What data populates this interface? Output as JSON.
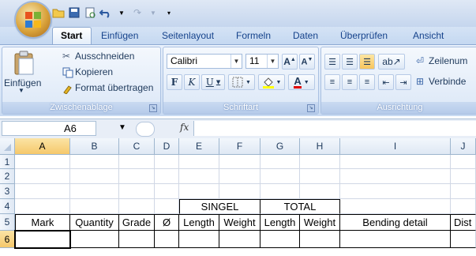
{
  "ribbon_tabs": [
    "Start",
    "Einfügen",
    "Seitenlayout",
    "Formeln",
    "Daten",
    "Überprüfen",
    "Ansicht"
  ],
  "active_tab": "Start",
  "clipboard": {
    "paste_label": "Einfügen",
    "cut_label": "Ausschneiden",
    "copy_label": "Kopieren",
    "format_painter_label": "Format übertragen",
    "group_label": "Zwischenablage"
  },
  "font": {
    "font_name": "Calibri",
    "font_size": "11",
    "bold": "F",
    "italic": "K",
    "underline": "U",
    "group_label": "Schriftart"
  },
  "alignment": {
    "wrap_label": "Zeilenum",
    "merge_label": "Verbinde",
    "group_label": "Ausrichtung"
  },
  "formula_bar": {
    "name_box": "A6",
    "fx_label": "fx",
    "formula": ""
  },
  "grid": {
    "columns": [
      "A",
      "B",
      "C",
      "D",
      "E",
      "F",
      "G",
      "H",
      "I",
      "J"
    ],
    "rows": [
      "1",
      "2",
      "3",
      "4",
      "5",
      "6"
    ],
    "active_cell": "A6",
    "row4": {
      "singel": "SINGEL",
      "total": "TOTAL"
    },
    "row5": [
      "Mark",
      "Quantity",
      "Grade",
      "Ø",
      "Length",
      "Weight",
      "Length",
      "Weight",
      "Bending detail",
      "Dist"
    ]
  },
  "colors": {
    "ribbon_accent": "#15428b",
    "selected_header": "#f5c86b"
  }
}
